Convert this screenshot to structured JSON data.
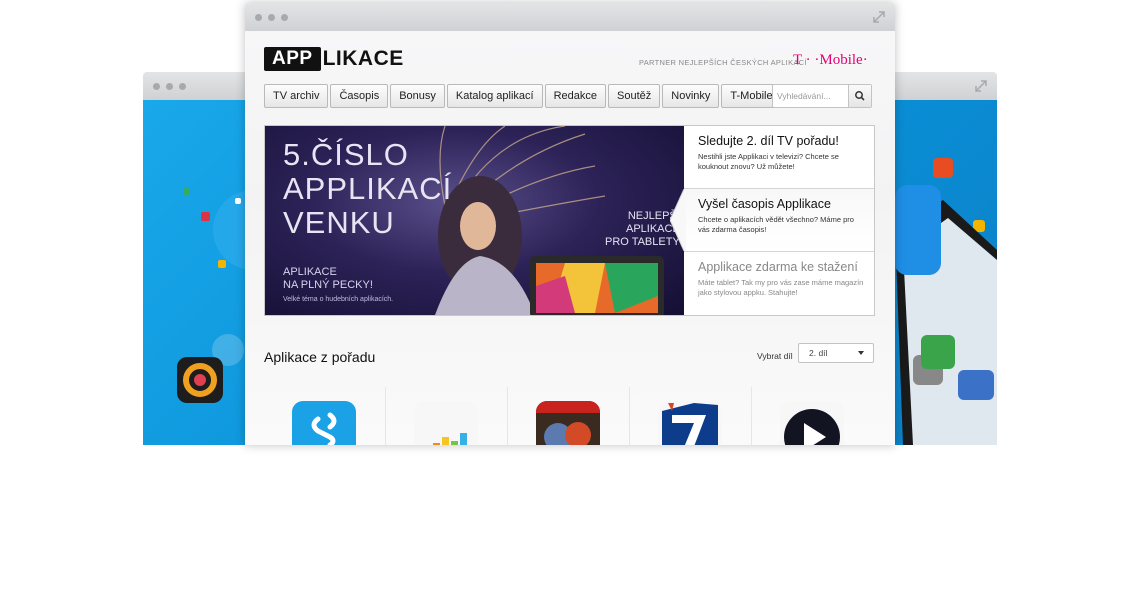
{
  "back_window": {
    "dots": [
      "",
      "",
      ""
    ]
  },
  "front_window": {
    "dots": [
      "",
      "",
      ""
    ]
  },
  "header": {
    "logo_box": "APP",
    "logo_rest": "LIKACE",
    "partner_text": "PARTNER NEJLEPŠÍCH ČESKÝCH APLIKACÍ",
    "brand": "T · ·Mobile·"
  },
  "nav": {
    "items": [
      "TV archiv",
      "Časopis",
      "Bonusy",
      "Katalog aplikací",
      "Redakce",
      "Soutěž",
      "Novinky",
      "T-Mobile"
    ]
  },
  "search": {
    "placeholder": "Vyhledávání..."
  },
  "banner": {
    "big_lines": [
      "5.ČÍSLO",
      "APPLIKACÍ",
      "VENKU"
    ],
    "small_lines": [
      "APLIKACE",
      "NA PLNÝ PECKY!"
    ],
    "tiny": "Velké téma o hudebních aplikacích.",
    "tablet_lines": [
      "NEJLEPŠÍ",
      "APLIKACE",
      "PRO TABLETY"
    ]
  },
  "features": [
    {
      "title": "Sledujte 2. díl TV pořadu!",
      "text": "Nestihli jste Applikaci v televizi? Chcete se kouknout znovu? Už můžete!"
    },
    {
      "title": "Vyšel časopis Applikace",
      "text": "Chcete o aplikacích vědět všechno? Máme pro vás zdarma časopis!"
    },
    {
      "title": "Applikace zdarma ke stažení",
      "text": "Máte tablet? Tak my pro vás zase máme magazín jako stylovou appku. Stahujte!"
    }
  ],
  "section": {
    "title": "Aplikace z pořadu",
    "select_label": "Vybrat díl",
    "select_value": "2. díl"
  },
  "apps": [
    "shazam-icon",
    "deezer-icon",
    "marvel-icon",
    "seven-icon",
    "video-player-icon"
  ],
  "colors": {
    "brand_magenta": "#e20074",
    "back_blue": "#129fe5",
    "banner_purple": "#2c2257"
  }
}
